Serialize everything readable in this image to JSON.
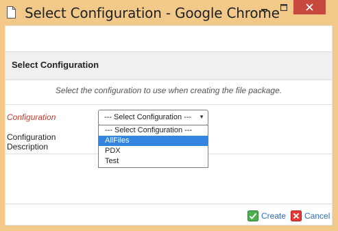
{
  "window": {
    "title": "Select Configuration - Google Chrome"
  },
  "section": {
    "title": "Select Configuration"
  },
  "instructions": "Select the configuration to use when creating the file package.",
  "form": {
    "configuration_label": "Configuration",
    "description_label": "Configuration Description",
    "select_value": "--- Select Configuration ---",
    "options": [
      "--- Select Configuration ---",
      "AllFiles",
      "PDX",
      "Test"
    ],
    "highlighted_option": "AllFiles"
  },
  "footer": {
    "create_label": "Create",
    "cancel_label": "Cancel"
  },
  "colors": {
    "title_bar": "#f3c98a",
    "close_button": "#c7483d",
    "link": "#2a6ebb",
    "required_label": "#c0392b",
    "highlight": "#3385e0"
  }
}
